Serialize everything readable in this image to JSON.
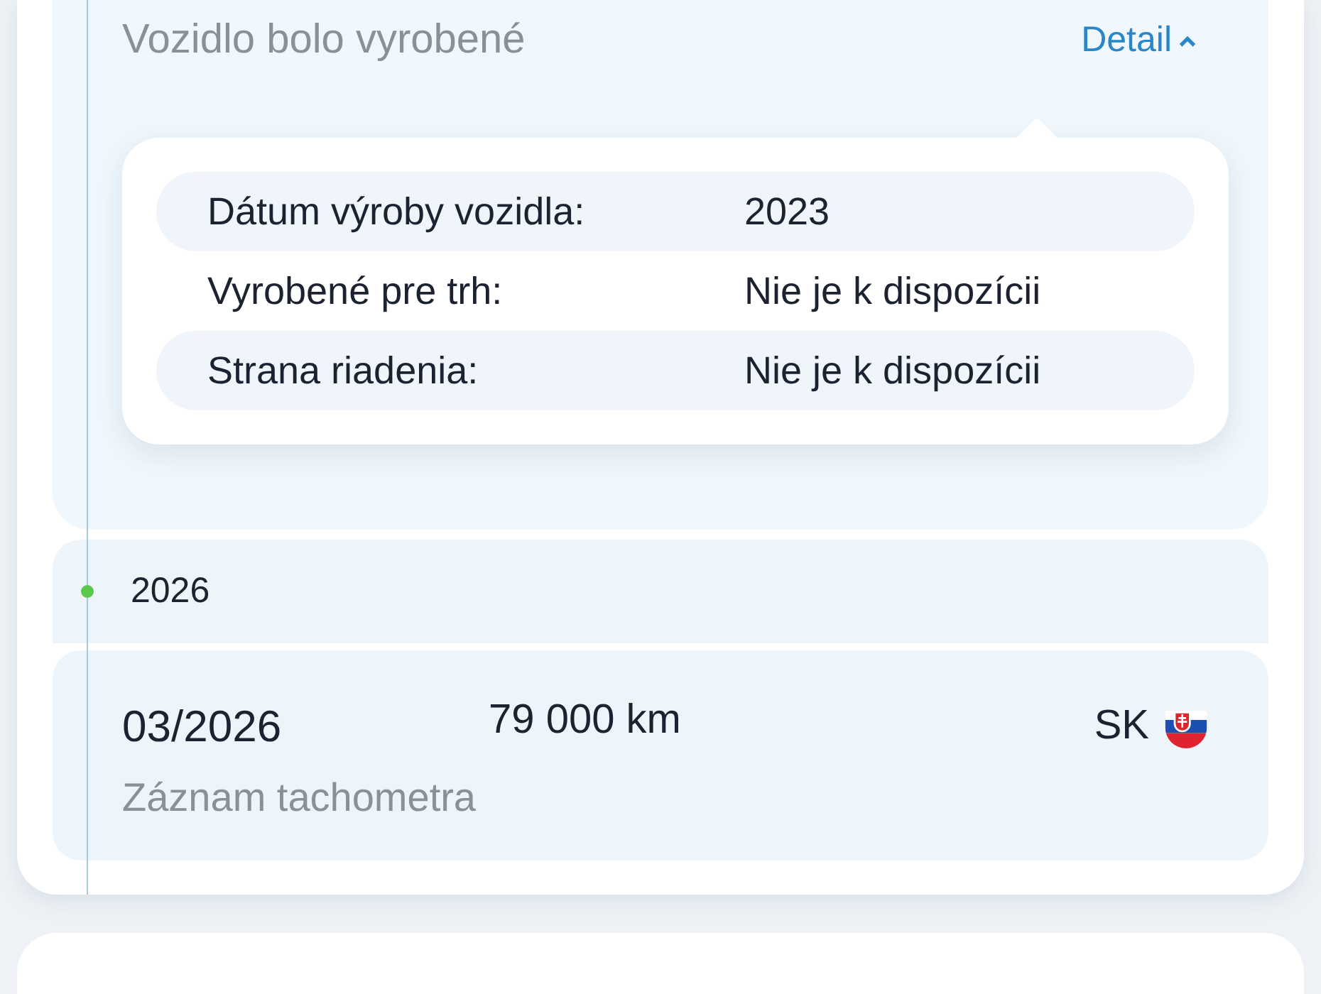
{
  "event": {
    "title": "Vozidlo bolo vyrobené",
    "detail_link": {
      "label": "Detail",
      "expanded": true
    },
    "details": [
      {
        "label": "Dátum výroby vozidla:",
        "value": "2023"
      },
      {
        "label": "Vyrobené pre trh:",
        "value": "Nie je k dispozícii"
      },
      {
        "label": "Strana riadenia:",
        "value": "Nie je k dispozícii"
      }
    ]
  },
  "year_group": {
    "year": "2026",
    "records": [
      {
        "date": "03/2026",
        "mileage": "79 000 km",
        "country": "SK",
        "type": "Záznam tachometra"
      }
    ]
  }
}
